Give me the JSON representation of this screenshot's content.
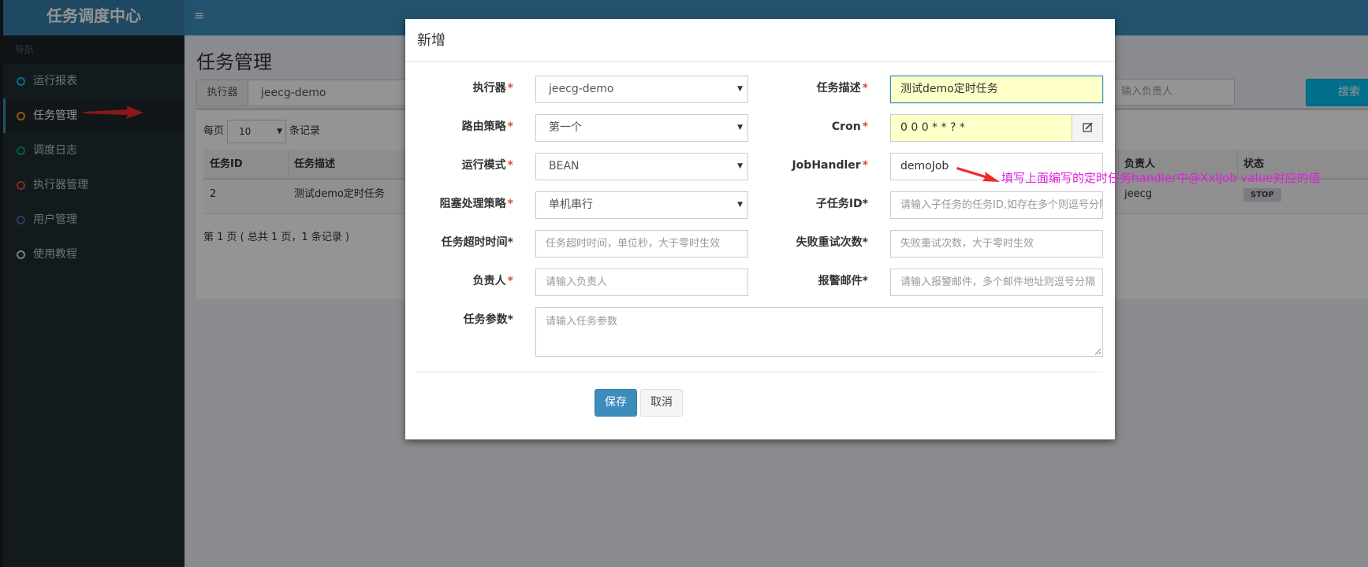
{
  "app": {
    "title": "任务调度中心",
    "menu_toggle": "≡"
  },
  "sidebar": {
    "header": "导航",
    "items": [
      {
        "label": "运行报表",
        "color": "#00c0ef",
        "active": false
      },
      {
        "label": "任务管理",
        "color": "#f39c12",
        "active": true
      },
      {
        "label": "调度日志",
        "color": "#00a65a",
        "active": false
      },
      {
        "label": "执行器管理",
        "color": "#dd4b39",
        "active": false
      },
      {
        "label": "用户管理",
        "color": "#605ca8",
        "active": false
      },
      {
        "label": "使用教程",
        "color": "#d2d6de",
        "active": false
      }
    ]
  },
  "page": {
    "title": "任务管理",
    "filter": {
      "executor_label": "执行器",
      "executor_value": "jeecg-demo",
      "owner_placeholder": "请输入负责人",
      "owner_visible": "输入负责人",
      "search_label": "搜索"
    },
    "per_page": {
      "prefix": "每页",
      "value": "10",
      "suffix": "条记录"
    },
    "table": {
      "columns": {
        "id": "任务ID",
        "desc": "任务描述",
        "owner": "负责人",
        "status": "状态"
      },
      "rows": [
        {
          "id": "2",
          "desc": "测试demo定时任务",
          "owner": "jeecg",
          "status": "STOP"
        }
      ]
    },
    "pager": "第 1 页 ( 总共 1 页，1 条记录 )"
  },
  "modal": {
    "title": "新增",
    "fields": {
      "executor": {
        "label": "执行器",
        "value": "jeecg-demo"
      },
      "route": {
        "label": "路由策略",
        "value": "第一个"
      },
      "glue": {
        "label": "运行模式",
        "value": "BEAN"
      },
      "block": {
        "label": "阻塞处理策略",
        "value": "单机串行"
      },
      "timeout": {
        "label": "任务超时时间",
        "placeholder": "任务超时时间，单位秒，大于零时生效"
      },
      "author": {
        "label": "负责人",
        "placeholder": "请输入负责人"
      },
      "param": {
        "label": "任务参数",
        "placeholder": "请输入任务参数"
      },
      "desc": {
        "label": "任务描述",
        "value": "测试demo定时任务"
      },
      "cron": {
        "label": "Cron",
        "value": "0 0 0 * * ? *"
      },
      "handler": {
        "label": "JobHandler",
        "value": "demoJob"
      },
      "child": {
        "label": "子任务ID",
        "placeholder": "请输入子任务的任务ID,如存在多个则逗号分隔"
      },
      "retry": {
        "label": "失败重试次数",
        "placeholder": "失败重试次数，大于零时生效"
      },
      "alarm": {
        "label": "报警邮件",
        "placeholder": "请输入报警邮件，多个邮件地址则逗号分隔"
      }
    },
    "buttons": {
      "save": "保存",
      "cancel": "取消"
    }
  },
  "annotation": {
    "text": "填写上面编写的定时任务handler中@XxlJob value对应的值",
    "color": "#e020e0",
    "arrow_color": "#ee2a2a"
  }
}
